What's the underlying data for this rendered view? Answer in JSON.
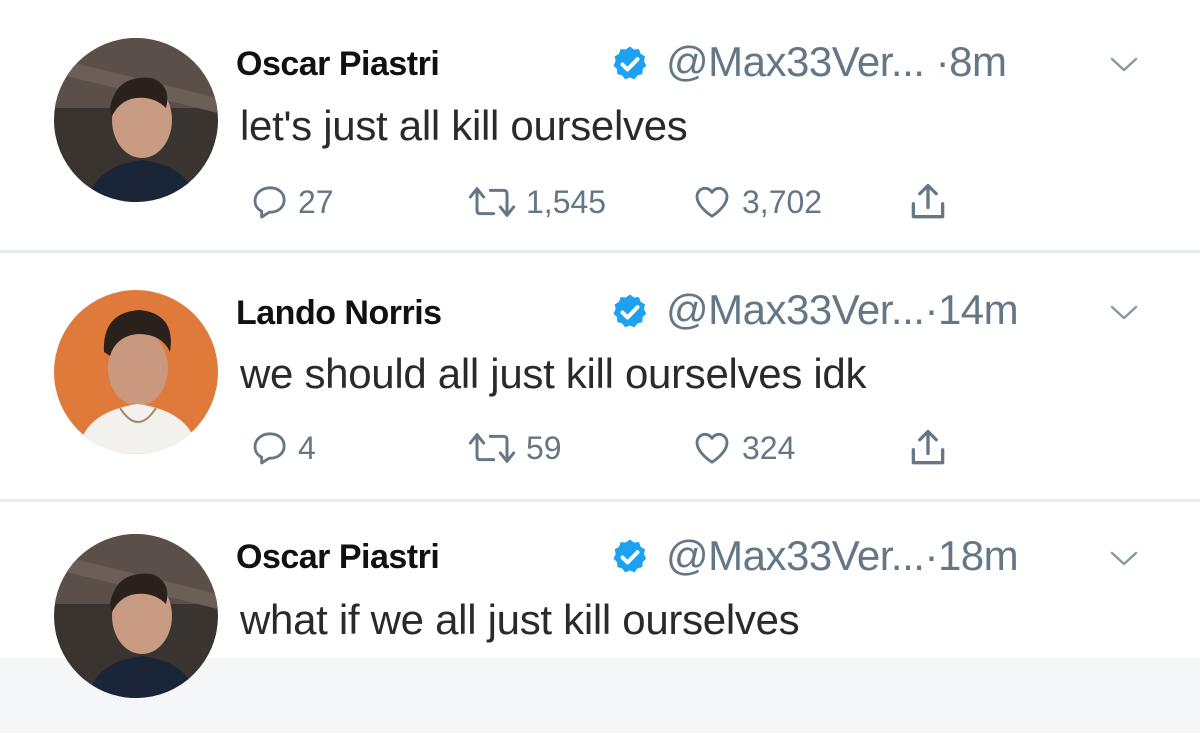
{
  "tweets": [
    {
      "author": "Oscar Piastri",
      "handle": "@Max33Ver...",
      "separator": "·",
      "time": "8m",
      "text": "let's just all kill ourselves",
      "replies": "27",
      "retweets": "1,545",
      "likes": "3,702",
      "avatar_bg": "#3a3431"
    },
    {
      "author": "Lando Norris",
      "handle": "@Max33Ver...",
      "separator": "·",
      "time": "14m",
      "text": "we should all just kill ourselves idk",
      "replies": "4",
      "retweets": "59",
      "likes": "324",
      "avatar_bg": "#e07a3a"
    },
    {
      "author": "Oscar Piastri",
      "handle": "@Max33Ver...",
      "separator": "·",
      "time": "18m",
      "text": "what if we all just kill ourselves",
      "avatar_bg": "#3a3431"
    }
  ],
  "colors": {
    "verified_blue": "#1da1f2",
    "secondary_text": "#657786"
  },
  "icons": {
    "reply": "reply-icon",
    "retweet": "retweet-icon",
    "like": "heart-icon",
    "share": "share-icon",
    "verified": "verified-badge-icon",
    "menu": "chevron-down-icon"
  }
}
